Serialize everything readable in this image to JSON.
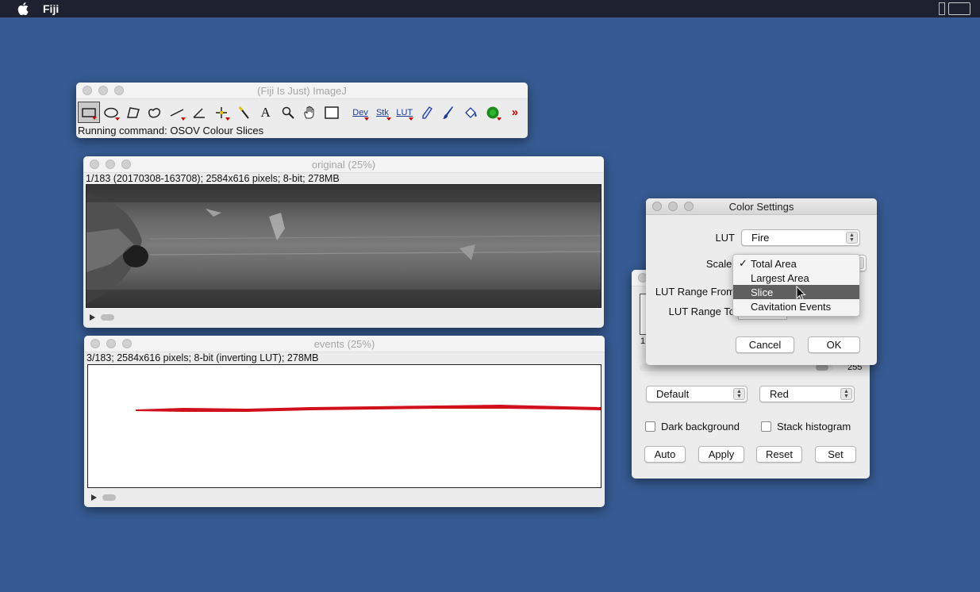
{
  "menubar": {
    "app_name": "Fiji"
  },
  "imagej": {
    "title": "(Fiji Is Just) ImageJ",
    "tools": [
      "Dev",
      "Stk",
      "LUT"
    ],
    "status": "Running command: OSOV Colour Slices"
  },
  "original": {
    "title": "original (25%)",
    "info": "1/183 (20170308-163708); 2584x616 pixels; 8-bit; 278MB"
  },
  "events": {
    "title": "events (25%)",
    "info": "3/183; 2584x616 pixels; 8-bit (inverting LUT); 278MB",
    "trace_color": "#d0101c"
  },
  "bc": {
    "max_value": "255",
    "min_partial": "1",
    "method_select": "Default",
    "color_select": "Red",
    "dark_background": "Dark background",
    "stack_histogram": "Stack histogram",
    "buttons": [
      "Auto",
      "Apply",
      "Reset",
      "Set"
    ]
  },
  "color_settings": {
    "title": "Color Settings",
    "lut_label": "LUT",
    "lut_value": "Fire",
    "scale_label": "Scale:",
    "lut_range_from_label": "LUT Range From",
    "lut_range_to_label": "LUT Range To",
    "scale_options": [
      "Total Area",
      "Largest Area",
      "Slice",
      "Cavitation Events"
    ],
    "scale_checked": "Total Area",
    "scale_highlighted": "Slice",
    "cancel_label": "Cancel",
    "ok_label": "OK"
  }
}
